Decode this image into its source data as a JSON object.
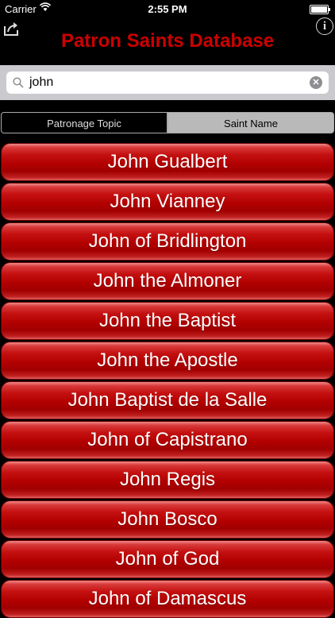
{
  "status_bar": {
    "carrier": "Carrier",
    "time": "2:55 PM"
  },
  "header": {
    "title": "Patron Saints Database"
  },
  "search": {
    "value": "john"
  },
  "segments": {
    "topic_label": "Patronage Topic",
    "name_label": "Saint Name",
    "selected": "Saint Name"
  },
  "saints": [
    "John Gualbert",
    "John Vianney",
    "John of Bridlington",
    "John the Almoner",
    "John the Baptist",
    "John the Apostle",
    "John Baptist de la Salle",
    "John of Capistrano",
    "John Regis",
    "John Bosco",
    "John of God",
    "John of Damascus"
  ],
  "colors": {
    "title_red": "#cc0000",
    "button_red": "#b20000",
    "background": "#000000"
  }
}
